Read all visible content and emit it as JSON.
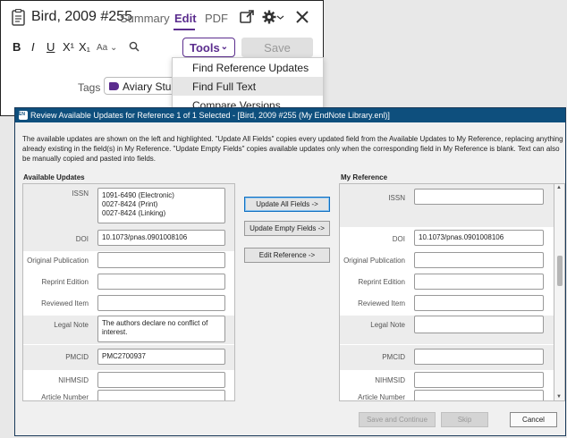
{
  "reference_window": {
    "title": "Bird, 2009 #255",
    "tabs": [
      {
        "label": "Summary",
        "active": false
      },
      {
        "label": "Edit",
        "active": true
      },
      {
        "label": "PDF",
        "active": false
      }
    ],
    "format_buttons": [
      "B",
      "I",
      "U",
      "X¹",
      "X₁",
      "Aa ⌄"
    ],
    "tools_label": "Tools",
    "save_label": "Save",
    "tags_label": "Tags",
    "tag_value": "Aviary Studies",
    "tools_menu": [
      {
        "label": "Find Reference Updates",
        "highlighted": false
      },
      {
        "label": "Find Full Text",
        "highlighted": true
      },
      {
        "label": "Compare Versions",
        "highlighted": false
      }
    ],
    "accent_color": "#5b2d8e"
  },
  "dialog": {
    "title": "Review Available Updates for Reference 1 of 1 Selected - [Bird, 2009 #255 (My EndNote Library.enl)]",
    "description": "The available updates are shown on the left and highlighted. \"Update All Fields\" copies every updated field from the Available Updates to My Reference, replacing anything already existing in the field(s) in My Reference. \"Update Empty Fields\" copies available updates only when the corresponding field in My Reference is blank. Text can also be manually copied and pasted into fields.",
    "available_heading": "Available Updates",
    "my_reference_heading": "My Reference",
    "available_fields": [
      {
        "label": "ISSN",
        "value": "1091-6490 (Electronic)\n0027-8424 (Print)\n0027-8424 (Linking)",
        "shaded": true
      },
      {
        "label": "DOI",
        "value": "10.1073/pnas.0901008106",
        "shaded": true
      },
      {
        "label": "Original Publication",
        "value": "",
        "shaded": false
      },
      {
        "label": "Reprint Edition",
        "value": "",
        "shaded": false
      },
      {
        "label": "Reviewed Item",
        "value": "",
        "shaded": false
      },
      {
        "label": "Legal Note",
        "value": "The authors declare no conflict of interest.",
        "shaded": true
      },
      {
        "label": "PMCID",
        "value": "PMC2700937",
        "shaded": true
      },
      {
        "label": "NIHMSID",
        "value": "",
        "shaded": false
      },
      {
        "label": "Article Number",
        "value": "",
        "shaded": false
      }
    ],
    "my_fields": [
      {
        "label": "ISSN",
        "value": "",
        "shaded": true
      },
      {
        "label": "DOI",
        "value": "10.1073/pnas.0901008106",
        "shaded": false
      },
      {
        "label": "Original Publication",
        "value": "",
        "shaded": false
      },
      {
        "label": "Reprint Edition",
        "value": "",
        "shaded": false
      },
      {
        "label": "Reviewed Item",
        "value": "",
        "shaded": false
      },
      {
        "label": "Legal Note",
        "value": "",
        "shaded": true
      },
      {
        "label": "PMCID",
        "value": "",
        "shaded": true
      },
      {
        "label": "NIHMSID",
        "value": "",
        "shaded": false
      },
      {
        "label": "Article Number",
        "value": "",
        "shaded": false
      }
    ],
    "update_all_label": "Update All Fields ->",
    "update_empty_label": "Update Empty Fields ->",
    "edit_reference_label": "Edit Reference ->",
    "save_continue_label": "Save and Continue",
    "skip_label": "Skip",
    "cancel_label": "Cancel",
    "titlebar_color": "#0e4f7d"
  }
}
